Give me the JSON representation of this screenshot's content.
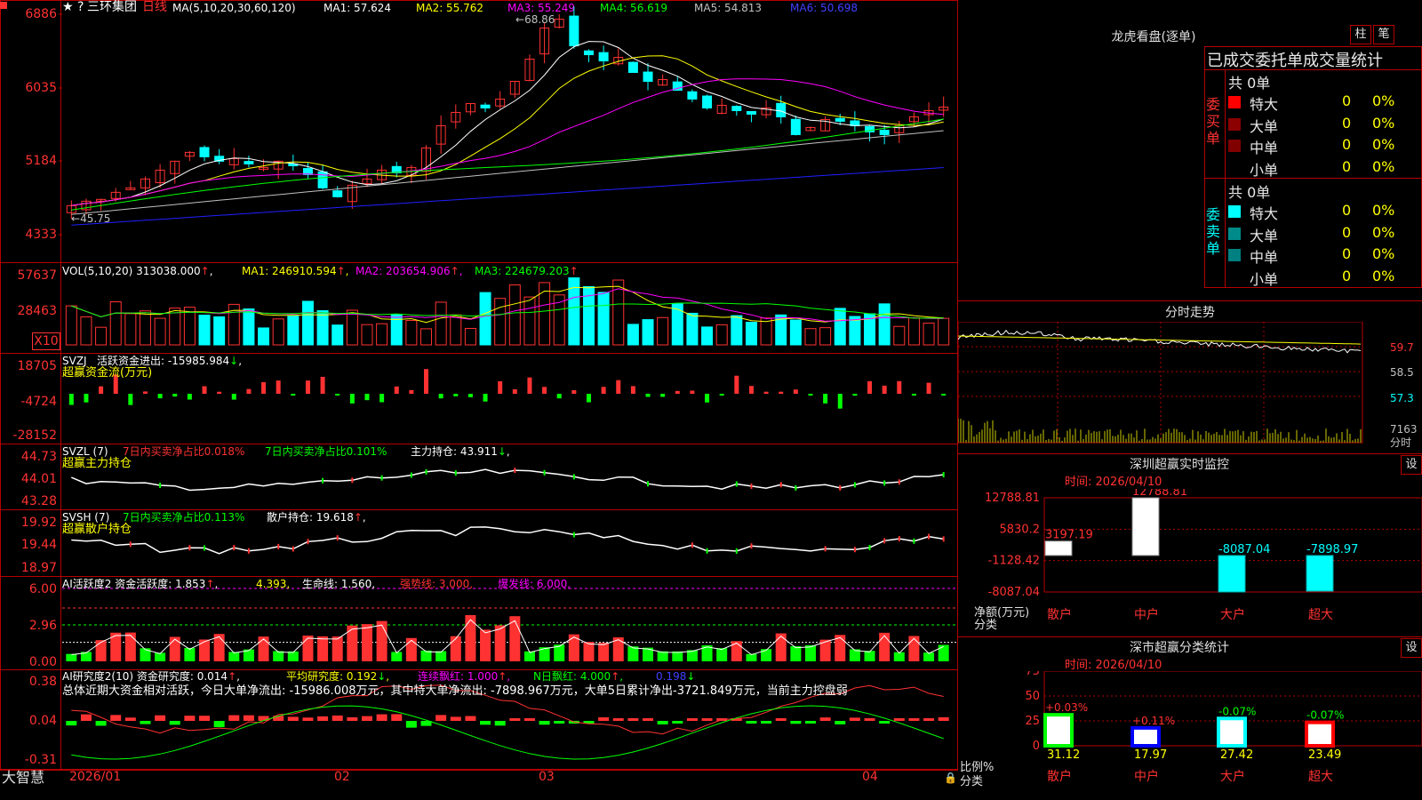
{
  "colors": {
    "up": "#ff3232",
    "down": "#00ffff",
    "grid": "#b40000",
    "ma1": "#ffffff",
    "ma2": "#ffff00",
    "ma3": "#ff00ff",
    "ma4": "#00ff00",
    "ma5": "#c0c0c0",
    "ma6": "#2020ff"
  },
  "kline": {
    "stock_name": "三环集团",
    "period": "日线",
    "ma_params": "MA(5,10,20,30,60,120)",
    "ma1": "MA1: 57.624",
    "ma2": "MA2: 55.762",
    "ma3": "MA3: 55.249",
    "ma4": "MA4: 56.619",
    "ma5": "MA5: 54.813",
    "ma6": "MA6: 50.698",
    "high_mark": "68.86",
    "low_mark": "45.75",
    "yticks": [
      "6886",
      "6035",
      "5184",
      "4333"
    ]
  },
  "vol": {
    "title": "VOL(5,10,20)",
    "value": "313038.000",
    "ma1": "MA1: 246910.594",
    "ma2": "MA2: 203654.906",
    "ma3": "MA3: 224679.203",
    "yticks": [
      "57637",
      "28463"
    ],
    "unit": "X10"
  },
  "svzj": {
    "title": "SVZJ",
    "text": "活跃资金进出: -15985.984",
    "sub": "超赢资金流(万元)",
    "yticks": [
      "18705",
      "-4724",
      "-28152"
    ]
  },
  "svzl": {
    "title": "SVZL (7)",
    "t1": "7日内买卖净占比0.018%",
    "t2": "7日内买卖净占比0.101%",
    "t3": "主力持仓: 43.911",
    "sub": "超赢主力持仓",
    "yticks": [
      "44.73",
      "44.01",
      "43.28"
    ]
  },
  "svsh": {
    "title": "SVSH (7)",
    "t1": "7日内买卖净占比0.113%",
    "t2": "散户持仓: 19.618",
    "sub": "超赢散户持仓",
    "yticks": [
      "19.92",
      "19.44",
      "18.97"
    ]
  },
  "ai2": {
    "title": "AI活跃度2",
    "t1": "资金活跃度: 1.853",
    "t2": "4.393",
    "t3": "生命线: 1.560",
    "t4": "强势线: 3.000",
    "t5": "爆发线: 6.000",
    "yticks": [
      "6.00",
      "2.96",
      "0.00"
    ]
  },
  "ai3": {
    "title": "AI研究度2(10)",
    "t1": "资金研究度: 0.014",
    "t2": "平均研究度: 0.192",
    "t3": "连续飘红: 1.000",
    "t4": "N日飘红: 4.000",
    "t5": "0.198",
    "summary": "总体近期大资金相对活跃，今日大单净流出: -15986.008万元，其中特大单净流出: -7898.967万元，大单5日累计净出-3721.849万元，当前主力控盘弱",
    "yticks": [
      "0.38",
      "0.04",
      "-0.31"
    ]
  },
  "xaxis": {
    "labels": [
      "2026/01",
      "02",
      "03",
      "04"
    ]
  },
  "brand": "大智慧",
  "lhb": {
    "title": "龙虎看盘(逐单)",
    "btn1": "柱",
    "btn2": "笔",
    "heading": "已成交委托单成交量统计",
    "buy": {
      "label": [
        "委",
        "买",
        "单"
      ],
      "total": "共 0单",
      "rows": [
        {
          "name": "特大",
          "v": "0",
          "p": "0%"
        },
        {
          "name": "大单",
          "v": "0",
          "p": "0%"
        },
        {
          "name": "中单",
          "v": "0",
          "p": "0%"
        },
        {
          "name": "小单",
          "v": "0",
          "p": "0%"
        }
      ]
    },
    "sell": {
      "label": [
        "委",
        "卖",
        "单"
      ],
      "total": "共 0单",
      "rows": [
        {
          "name": "特大",
          "v": "0",
          "p": "0%"
        },
        {
          "name": "大单",
          "v": "0",
          "p": "0%"
        },
        {
          "name": "中单",
          "v": "0",
          "p": "0%"
        },
        {
          "name": "小单",
          "v": "0",
          "p": "0%"
        }
      ]
    }
  },
  "fenshi": {
    "title": "分时走势",
    "yticks": [
      "59.7",
      "58.5",
      "57.3",
      "7163",
      "分时"
    ]
  },
  "sz_monitor": {
    "title": "深圳超赢实时监控",
    "btn": "设",
    "time": "时间: 2026/04/10",
    "yticks": [
      "12788.81",
      "5830.2",
      "-1128.42",
      "-8087.04"
    ],
    "ylabel": "净额(万元)",
    "xlabel": "分类",
    "chart_data": {
      "type": "bar",
      "categories": [
        "散户",
        "中户",
        "大户",
        "超大"
      ],
      "values": [
        3197.19,
        12788.81,
        -8087.04,
        -7898.97
      ],
      "value_labels": [
        "3197.19",
        "12788.81",
        "-8087.04",
        "-7898.97"
      ],
      "ylim": [
        -8087.04,
        12788.81
      ]
    }
  },
  "sz_class": {
    "title": "深市超赢分类统计",
    "btn": "设",
    "time": "时间: 2026/04/10",
    "yticks": [
      "75",
      "50",
      "25",
      "0"
    ],
    "ylabel": "比例%",
    "xlabel": "分类",
    "chart_data": {
      "type": "bar",
      "categories": [
        "散户",
        "中户",
        "大户",
        "超大"
      ],
      "values": [
        31.12,
        17.97,
        27.42,
        23.49
      ],
      "changes": [
        "+0.03%",
        "+0.11%",
        "-0.07%",
        "-0.07%"
      ],
      "ylim": [
        0,
        75
      ]
    }
  }
}
